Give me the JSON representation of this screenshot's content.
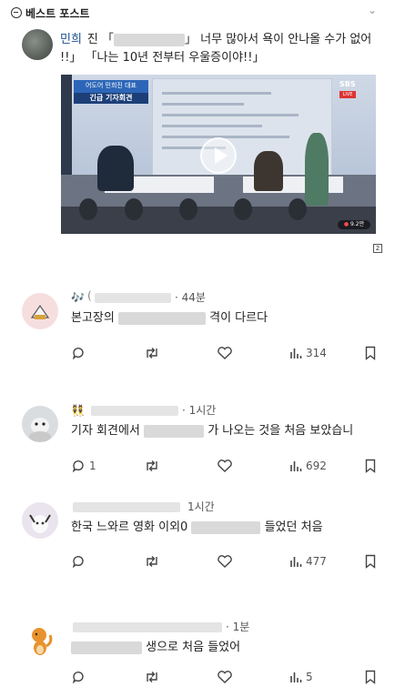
{
  "header": {
    "title": "베스트 포스트",
    "icon": "minus-circle-icon",
    "chevron": "chevron-down-icon"
  },
  "post": {
    "name": "민희",
    "text_line1_a": "진 「",
    "text_line1_b": "」 너무 많아서 욕이 안나올 수가 없어",
    "text_line2": "!!」 「나는 10년 전부터 우울증이야!!」"
  },
  "video": {
    "title_line1": "어도어 민희진 대표",
    "title_line2": "긴급 기자회견",
    "channel": "SBS",
    "live_label": "LIVE",
    "views": "9.2만"
  },
  "page_badge": "2",
  "replies": [
    {
      "badge": "🎶",
      "user_prefix": "(",
      "time": "· 44분",
      "text_a": "본고장의",
      "text_b": "격이 다르다",
      "reply_count": "",
      "views": "314"
    },
    {
      "badge": "👯",
      "user_prefix": "",
      "time": "· 1시간",
      "text_a": "기자 회견에서",
      "text_b": "가 나오는 것을 처음 보았습니",
      "reply_count": "1",
      "views": "692"
    },
    {
      "badge": "",
      "user_prefix": "",
      "time": "1시간",
      "text_a": "한국 느와르 영화 이외0",
      "text_b": "들었던 처음",
      "reply_count": "",
      "views": "477"
    },
    {
      "badge": "",
      "user_prefix": "",
      "time": "· 1분",
      "text_a": "",
      "text_b": "생으로 처음 들었어",
      "reply_count": "",
      "views": "5"
    }
  ],
  "icons": {
    "reply": "reply-bubble-icon",
    "repost": "repost-icon",
    "like": "heart-icon",
    "views": "views-bar-icon",
    "bookmark": "bookmark-icon"
  },
  "colors": {
    "link_blue": "#1a4e8c",
    "text": "#222222",
    "muted": "#555555"
  }
}
